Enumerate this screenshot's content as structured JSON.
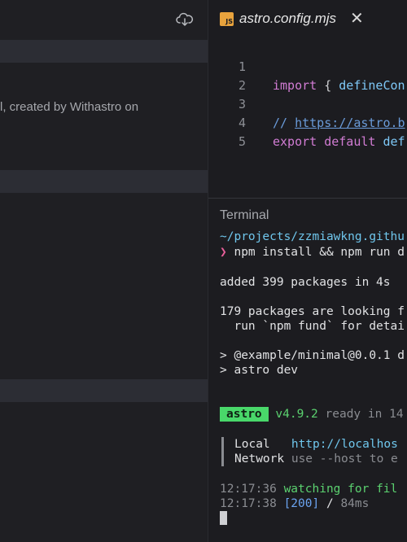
{
  "left_panel": {
    "description_fragment": "l, created by Withastro on"
  },
  "editor": {
    "tab_filename": "astro.config.mjs",
    "tab_icon_label": "JS",
    "lines": [
      {
        "number": "1",
        "kw": "import",
        "rest_punc": " { ",
        "rest_fn": "defineCon"
      },
      {
        "number": "2"
      },
      {
        "number": "3",
        "comment_prefix": "// ",
        "comment_url": "https://astro.b"
      },
      {
        "number": "4",
        "kw1": "export",
        "kw2": "default",
        "rest_fn": "def"
      },
      {
        "number": "5"
      }
    ]
  },
  "terminal": {
    "title": "Terminal",
    "cwd": "~/projects/zzmiawkng.githu",
    "prompt_symbol": "❯",
    "command": "npm install && npm run d",
    "added": "added 399 packages in 4s",
    "fund_line1": "179 packages are looking f",
    "fund_line2": "  run `npm fund` for detai",
    "script_line1": "> @example/minimal@0.0.1 d",
    "script_line2": "> astro dev",
    "badge": "astro",
    "version": "v4.9.2",
    "ready_text": "ready in 14",
    "local_label": "Local",
    "local_url": "http://localhos",
    "network_label": "Network",
    "network_hint": "use --host to e",
    "log1_time": "12:17:36",
    "log1_text": "watching for fil",
    "log2_time": "12:17:38",
    "log2_status": "[200]",
    "log2_path": "/",
    "log2_ms": "84ms"
  },
  "icons": [
    "cloud-download-icon",
    "js-file-icon",
    "close-icon"
  ],
  "colors": {
    "accent_green": "#49d86a",
    "keyword": "#d17cd3",
    "function": "#7ec8f7",
    "js_icon": "#e8a33d"
  }
}
